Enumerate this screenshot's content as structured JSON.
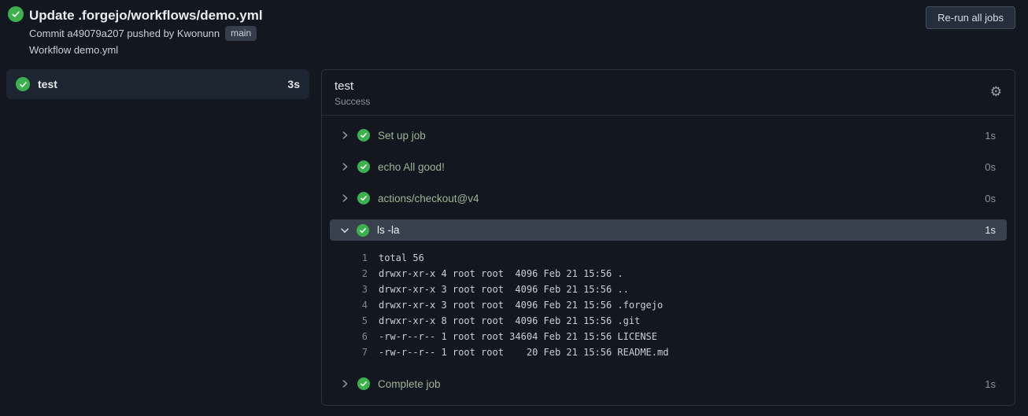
{
  "header": {
    "title": "Update .forgejo/workflows/demo.yml",
    "commit": {
      "label": "Commit ",
      "sha": "a49079a207",
      "pushed": " pushed by ",
      "author": "Kwonunn",
      "branch": "main"
    },
    "workflow_text": "Workflow demo.yml",
    "rerun_label": "Re-run all jobs"
  },
  "sidebar": {
    "jobs": [
      {
        "name": "test",
        "duration": "3s",
        "status": "success"
      }
    ]
  },
  "panel": {
    "title": "test",
    "status": "Success",
    "steps": [
      {
        "label": "Set up job",
        "duration": "1s",
        "expanded": false
      },
      {
        "label": "echo All good!",
        "duration": "0s",
        "expanded": false
      },
      {
        "label": "actions/checkout@v4",
        "duration": "0s",
        "expanded": false
      },
      {
        "label": "ls -la",
        "duration": "1s",
        "expanded": true,
        "logs": [
          {
            "num": "1",
            "text": "total 56"
          },
          {
            "num": "2",
            "text": "drwxr-xr-x 4 root root  4096 Feb 21 15:56 ."
          },
          {
            "num": "3",
            "text": "drwxr-xr-x 3 root root  4096 Feb 21 15:56 .."
          },
          {
            "num": "4",
            "text": "drwxr-xr-x 3 root root  4096 Feb 21 15:56 .forgejo"
          },
          {
            "num": "5",
            "text": "drwxr-xr-x 8 root root  4096 Feb 21 15:56 .git"
          },
          {
            "num": "6",
            "text": "-rw-r--r-- 1 root root 34604 Feb 21 15:56 LICENSE"
          },
          {
            "num": "7",
            "text": "-rw-r--r-- 1 root root    20 Feb 21 15:56 README.md"
          }
        ]
      },
      {
        "label": "Complete job",
        "duration": "1s",
        "expanded": false
      }
    ]
  },
  "icons": {
    "gear_glyph": "⚙",
    "success": "check-circle"
  },
  "colors": {
    "background": "#131720",
    "success_green": "#3cb14e",
    "panel_border": "#2c323d",
    "selected_row_bg": "#3a414e",
    "step_label_green": "#9eb394",
    "muted_text": "#8b939e",
    "badge_bg": "#363e4b",
    "button_border": "#454e5c"
  }
}
